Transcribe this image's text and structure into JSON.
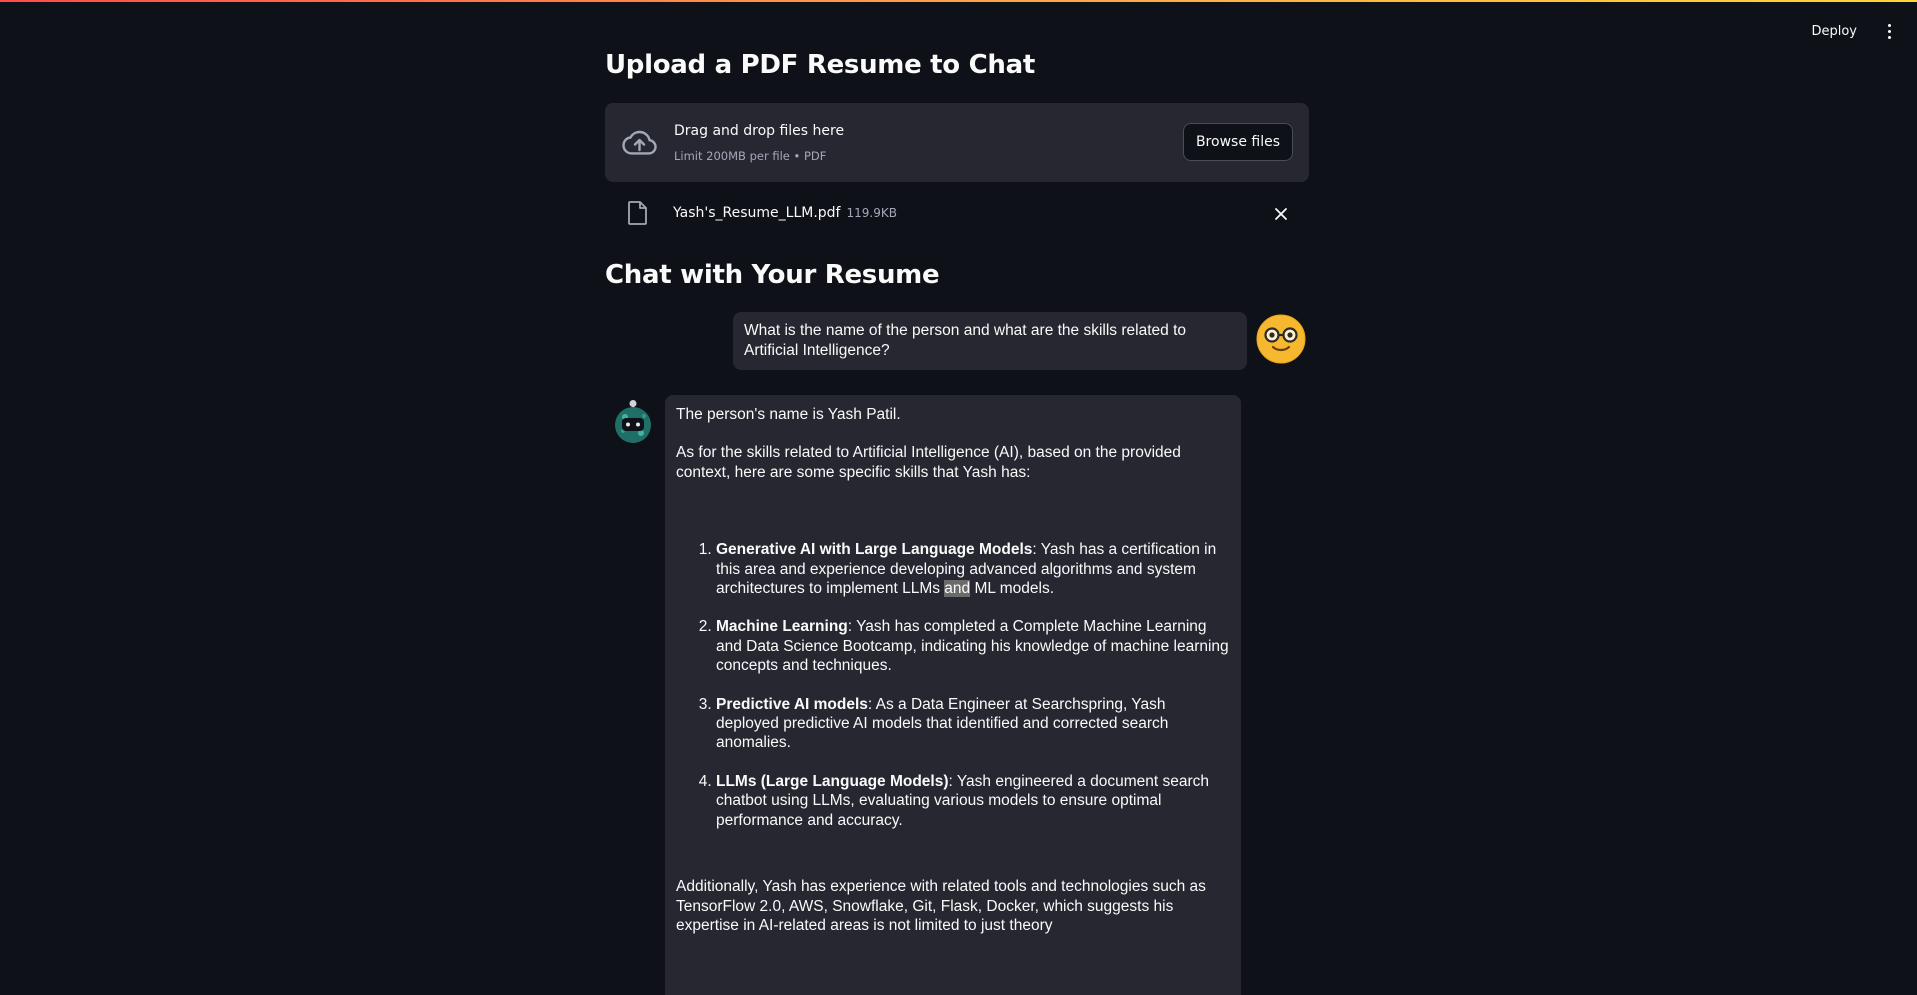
{
  "header": {
    "deploy_label": "Deploy"
  },
  "page_title": "Upload a PDF Resume to Chat",
  "uploader": {
    "title": "Drag and drop files here",
    "subtitle": "Limit 200MB per file • PDF",
    "browse_label": "Browse files",
    "file_name": "Yash's_Resume_LLM.pdf",
    "file_size": "119.9KB"
  },
  "chat_title": "Chat with Your Resume",
  "messages": {
    "user": "What is the name of the person and what are the skills related to Artificial Intelligence?",
    "assistant": {
      "p1": "The person's name is Yash Patil.",
      "p2": "As for the skills related to Artificial Intelligence (AI), based on the provided context, here are some specific skills that Yash has:",
      "items": [
        {
          "title": "Generative AI with Large Language Models",
          "text_before": ": Yash has a certification in this area and experience developing advanced algorithms and system architectures to implement LLMs ",
          "highlight": "and",
          "text_after": " ML models."
        },
        {
          "title": "Machine Learning",
          "text": ": Yash has completed a Complete Machine Learning and Data Science Bootcamp, indicating his knowledge of machine learning concepts and techniques."
        },
        {
          "title": "Predictive AI models",
          "text": ": As a Data Engineer at Searchspring, Yash deployed predictive AI models that identified and corrected search anomalies."
        },
        {
          "title": "LLMs (Large Language Models)",
          "text": ": Yash engineered a document search chatbot using LLMs, evaluating various models to ensure optimal performance and accuracy."
        }
      ],
      "p3": "Additionally, Yash has experience with related tools and technologies such as TensorFlow 2.0, AWS, Snowflake, Git, Flask, Docker, which suggests his expertise in AI-related areas is not limited to just theory"
    }
  },
  "colors": {
    "background": "#0e1117",
    "surface": "#262730",
    "text": "#fafafa",
    "muted": "#a3a8b8",
    "accent_start": "#ff4b4b",
    "accent_end": "#fdd835"
  }
}
